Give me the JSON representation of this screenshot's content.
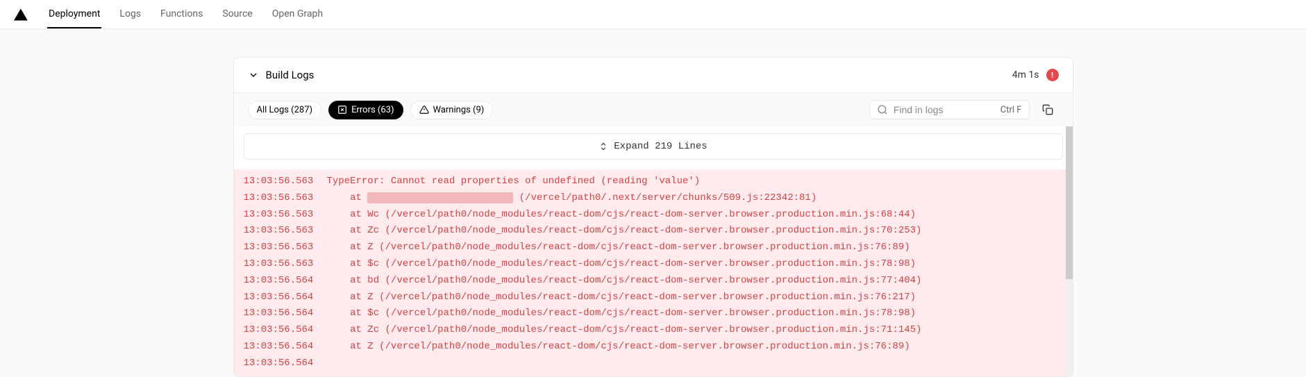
{
  "nav": {
    "tabs": [
      "Deployment",
      "Logs",
      "Functions",
      "Source",
      "Open Graph"
    ],
    "activeIndex": 0
  },
  "panel": {
    "title": "Build Logs",
    "duration": "4m 1s",
    "statusIcon": "!"
  },
  "filters": {
    "all": "All Logs (287)",
    "errors": "Errors (63)",
    "warnings": "Warnings (9)"
  },
  "search": {
    "placeholder": "Find in logs",
    "shortcut": "Ctrl F"
  },
  "expand": {
    "label": "Expand 219 Lines"
  },
  "logs": [
    {
      "time": "13:03:56.563",
      "text": "TypeError: Cannot read properties of undefined (reading 'value')"
    },
    {
      "time": "13:03:56.563",
      "text": "    at ",
      "redacted": "XxxxXXXxxxxxxxXxxxXxxxxxx",
      "suffix": " (/vercel/path0/.next/server/chunks/509.js:22342:81)"
    },
    {
      "time": "13:03:56.563",
      "text": "    at Wc (/vercel/path0/node_modules/react-dom/cjs/react-dom-server.browser.production.min.js:68:44)"
    },
    {
      "time": "13:03:56.563",
      "text": "    at Zc (/vercel/path0/node_modules/react-dom/cjs/react-dom-server.browser.production.min.js:70:253)"
    },
    {
      "time": "13:03:56.563",
      "text": "    at Z (/vercel/path0/node_modules/react-dom/cjs/react-dom-server.browser.production.min.js:76:89)"
    },
    {
      "time": "13:03:56.563",
      "text": "    at $c (/vercel/path0/node_modules/react-dom/cjs/react-dom-server.browser.production.min.js:78:98)"
    },
    {
      "time": "13:03:56.564",
      "text": "    at bd (/vercel/path0/node_modules/react-dom/cjs/react-dom-server.browser.production.min.js:77:404)"
    },
    {
      "time": "13:03:56.564",
      "text": "    at Z (/vercel/path0/node_modules/react-dom/cjs/react-dom-server.browser.production.min.js:76:217)"
    },
    {
      "time": "13:03:56.564",
      "text": "    at $c (/vercel/path0/node_modules/react-dom/cjs/react-dom-server.browser.production.min.js:78:98)"
    },
    {
      "time": "13:03:56.564",
      "text": "    at Zc (/vercel/path0/node_modules/react-dom/cjs/react-dom-server.browser.production.min.js:71:145)"
    },
    {
      "time": "13:03:56.564",
      "text": "    at Z (/vercel/path0/node_modules/react-dom/cjs/react-dom-server.browser.production.min.js:76:89)"
    },
    {
      "time": "13:03:56.564",
      "text": ""
    }
  ]
}
